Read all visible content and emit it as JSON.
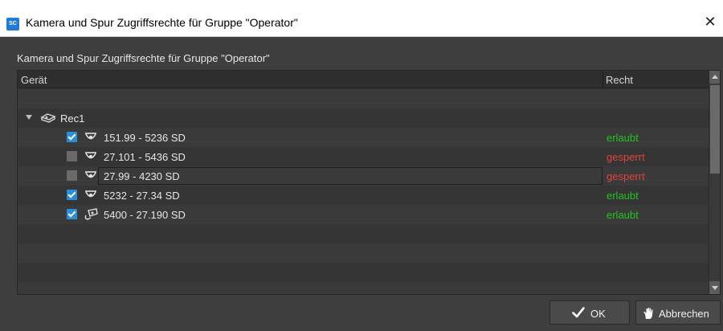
{
  "window": {
    "title": "Kamera und Spur Zugriffsrechte für Gruppe \"Operator\"",
    "app_icon_text": "SC",
    "close_glyph": "✕"
  },
  "caption": "Kamera und Spur Zugriffsrechte für Gruppe \"Operator\"",
  "grid": {
    "columns": {
      "device": "Gerät",
      "right": "Recht"
    },
    "recorder": {
      "label": "Rec1",
      "icon": "recorder-icon",
      "expanded": true
    },
    "devices": [
      {
        "label": "151.99 - 5236 SD",
        "checked": true,
        "right": "erlaubt",
        "icon": "dome-camera-icon"
      },
      {
        "label": "27.101 - 5436 SD",
        "checked": false,
        "right": "gesperrt",
        "icon": "dome-camera-icon"
      },
      {
        "label": "27.99 - 4230 SD",
        "checked": false,
        "right": "gesperrt",
        "icon": "dome-camera-icon",
        "focused": true
      },
      {
        "label": "5232 - 27.34 SD",
        "checked": true,
        "right": "erlaubt",
        "icon": "dome-camera-icon"
      },
      {
        "label": "5400 - 27.190 SD",
        "checked": true,
        "right": "erlaubt",
        "icon": "ptz-camera-icon"
      }
    ]
  },
  "buttons": {
    "ok": {
      "label": "OK",
      "icon": "checkmark-icon"
    },
    "cancel": {
      "label": "Abbrechen",
      "icon": "hand-icon"
    }
  },
  "colors": {
    "allowed": "#22c422",
    "blocked": "#e0453a",
    "checkbox_on": "#2b8fd8",
    "background": "#3e3e3e"
  }
}
